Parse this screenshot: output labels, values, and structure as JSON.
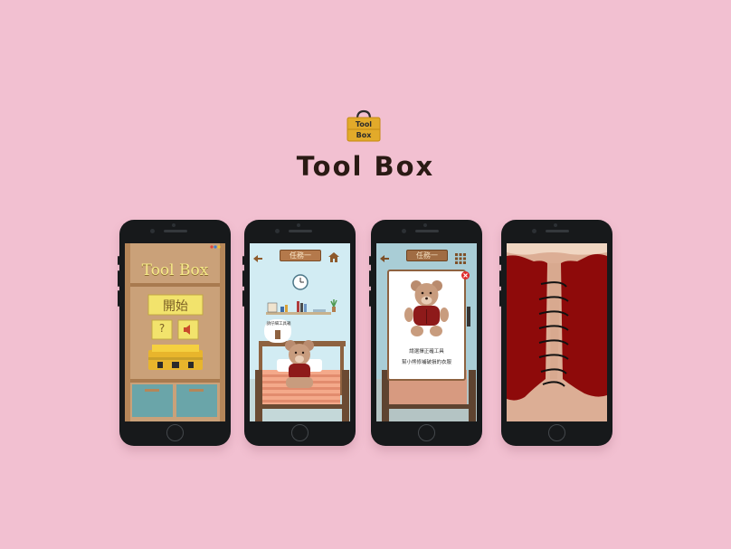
{
  "brand": {
    "logo_line1": "Tool",
    "logo_line2": "Box",
    "title": "Tool Box"
  },
  "colors": {
    "background": "#f2c0d1",
    "phone_body": "#17191b",
    "accent_gold": "#e2aa2a",
    "wood": "#c98e5a",
    "bear_shirt": "#8e1a1a"
  },
  "screens": [
    {
      "name": "home",
      "game_title": "Tool Box",
      "start_button": "開始",
      "help_button": "?",
      "sound_icon": "speaker-icon"
    },
    {
      "name": "mission-room",
      "header_label": "任務一",
      "back_icon": "back-arrow-icon",
      "home_icon": "house-icon",
      "hint_text": "請仔細工具箱"
    },
    {
      "name": "mission-popup",
      "header_label": "任務一",
      "back_icon": "back-arrow-icon",
      "menu_icon": "grid-icon",
      "close_icon": "close-icon",
      "prompt_line1": "請選擇正確工具",
      "prompt_line2": "幫小熊修補破損的衣服"
    },
    {
      "name": "stitching-closeup",
      "description_icon": "stitch-icon"
    }
  ]
}
